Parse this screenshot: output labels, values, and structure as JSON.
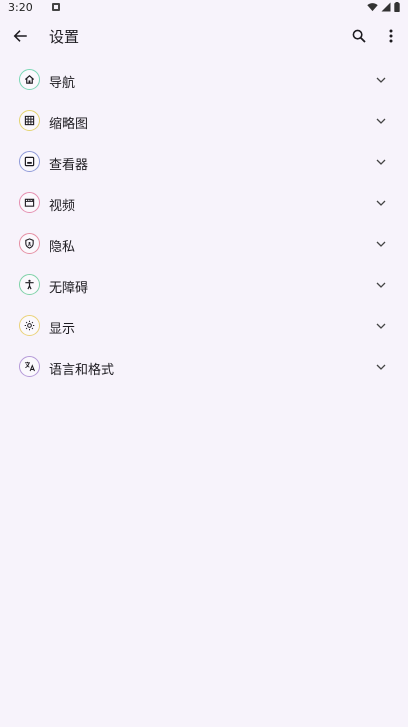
{
  "status_bar": {
    "time": "3:20",
    "notification_icon": "notification-square-icon",
    "wifi_icon": "wifi-icon",
    "signal_icon": "cell-signal-icon",
    "battery_icon": "battery-icon"
  },
  "app_bar": {
    "title": "设置",
    "back_icon": "arrow-back-icon",
    "search_icon": "search-icon",
    "more_icon": "more-vertical-icon"
  },
  "settings": {
    "items": [
      {
        "label": "导航",
        "icon": "home-icon",
        "color": "#7ad7b5"
      },
      {
        "label": "缩略图",
        "icon": "grid-icon",
        "color": "#e3d36f"
      },
      {
        "label": "查看器",
        "icon": "image-frame-icon",
        "color": "#8f9ad8"
      },
      {
        "label": "视频",
        "icon": "clapperboard-icon",
        "color": "#e58fb0"
      },
      {
        "label": "隐私",
        "icon": "shield-lock-icon",
        "color": "#e58fa3"
      },
      {
        "label": "无障碍",
        "icon": "accessibility-icon",
        "color": "#7fd2a8"
      },
      {
        "label": "显示",
        "icon": "brightness-icon",
        "color": "#ead27a"
      },
      {
        "label": "语言和格式",
        "icon": "translate-icon",
        "color": "#b59ad8"
      }
    ]
  }
}
